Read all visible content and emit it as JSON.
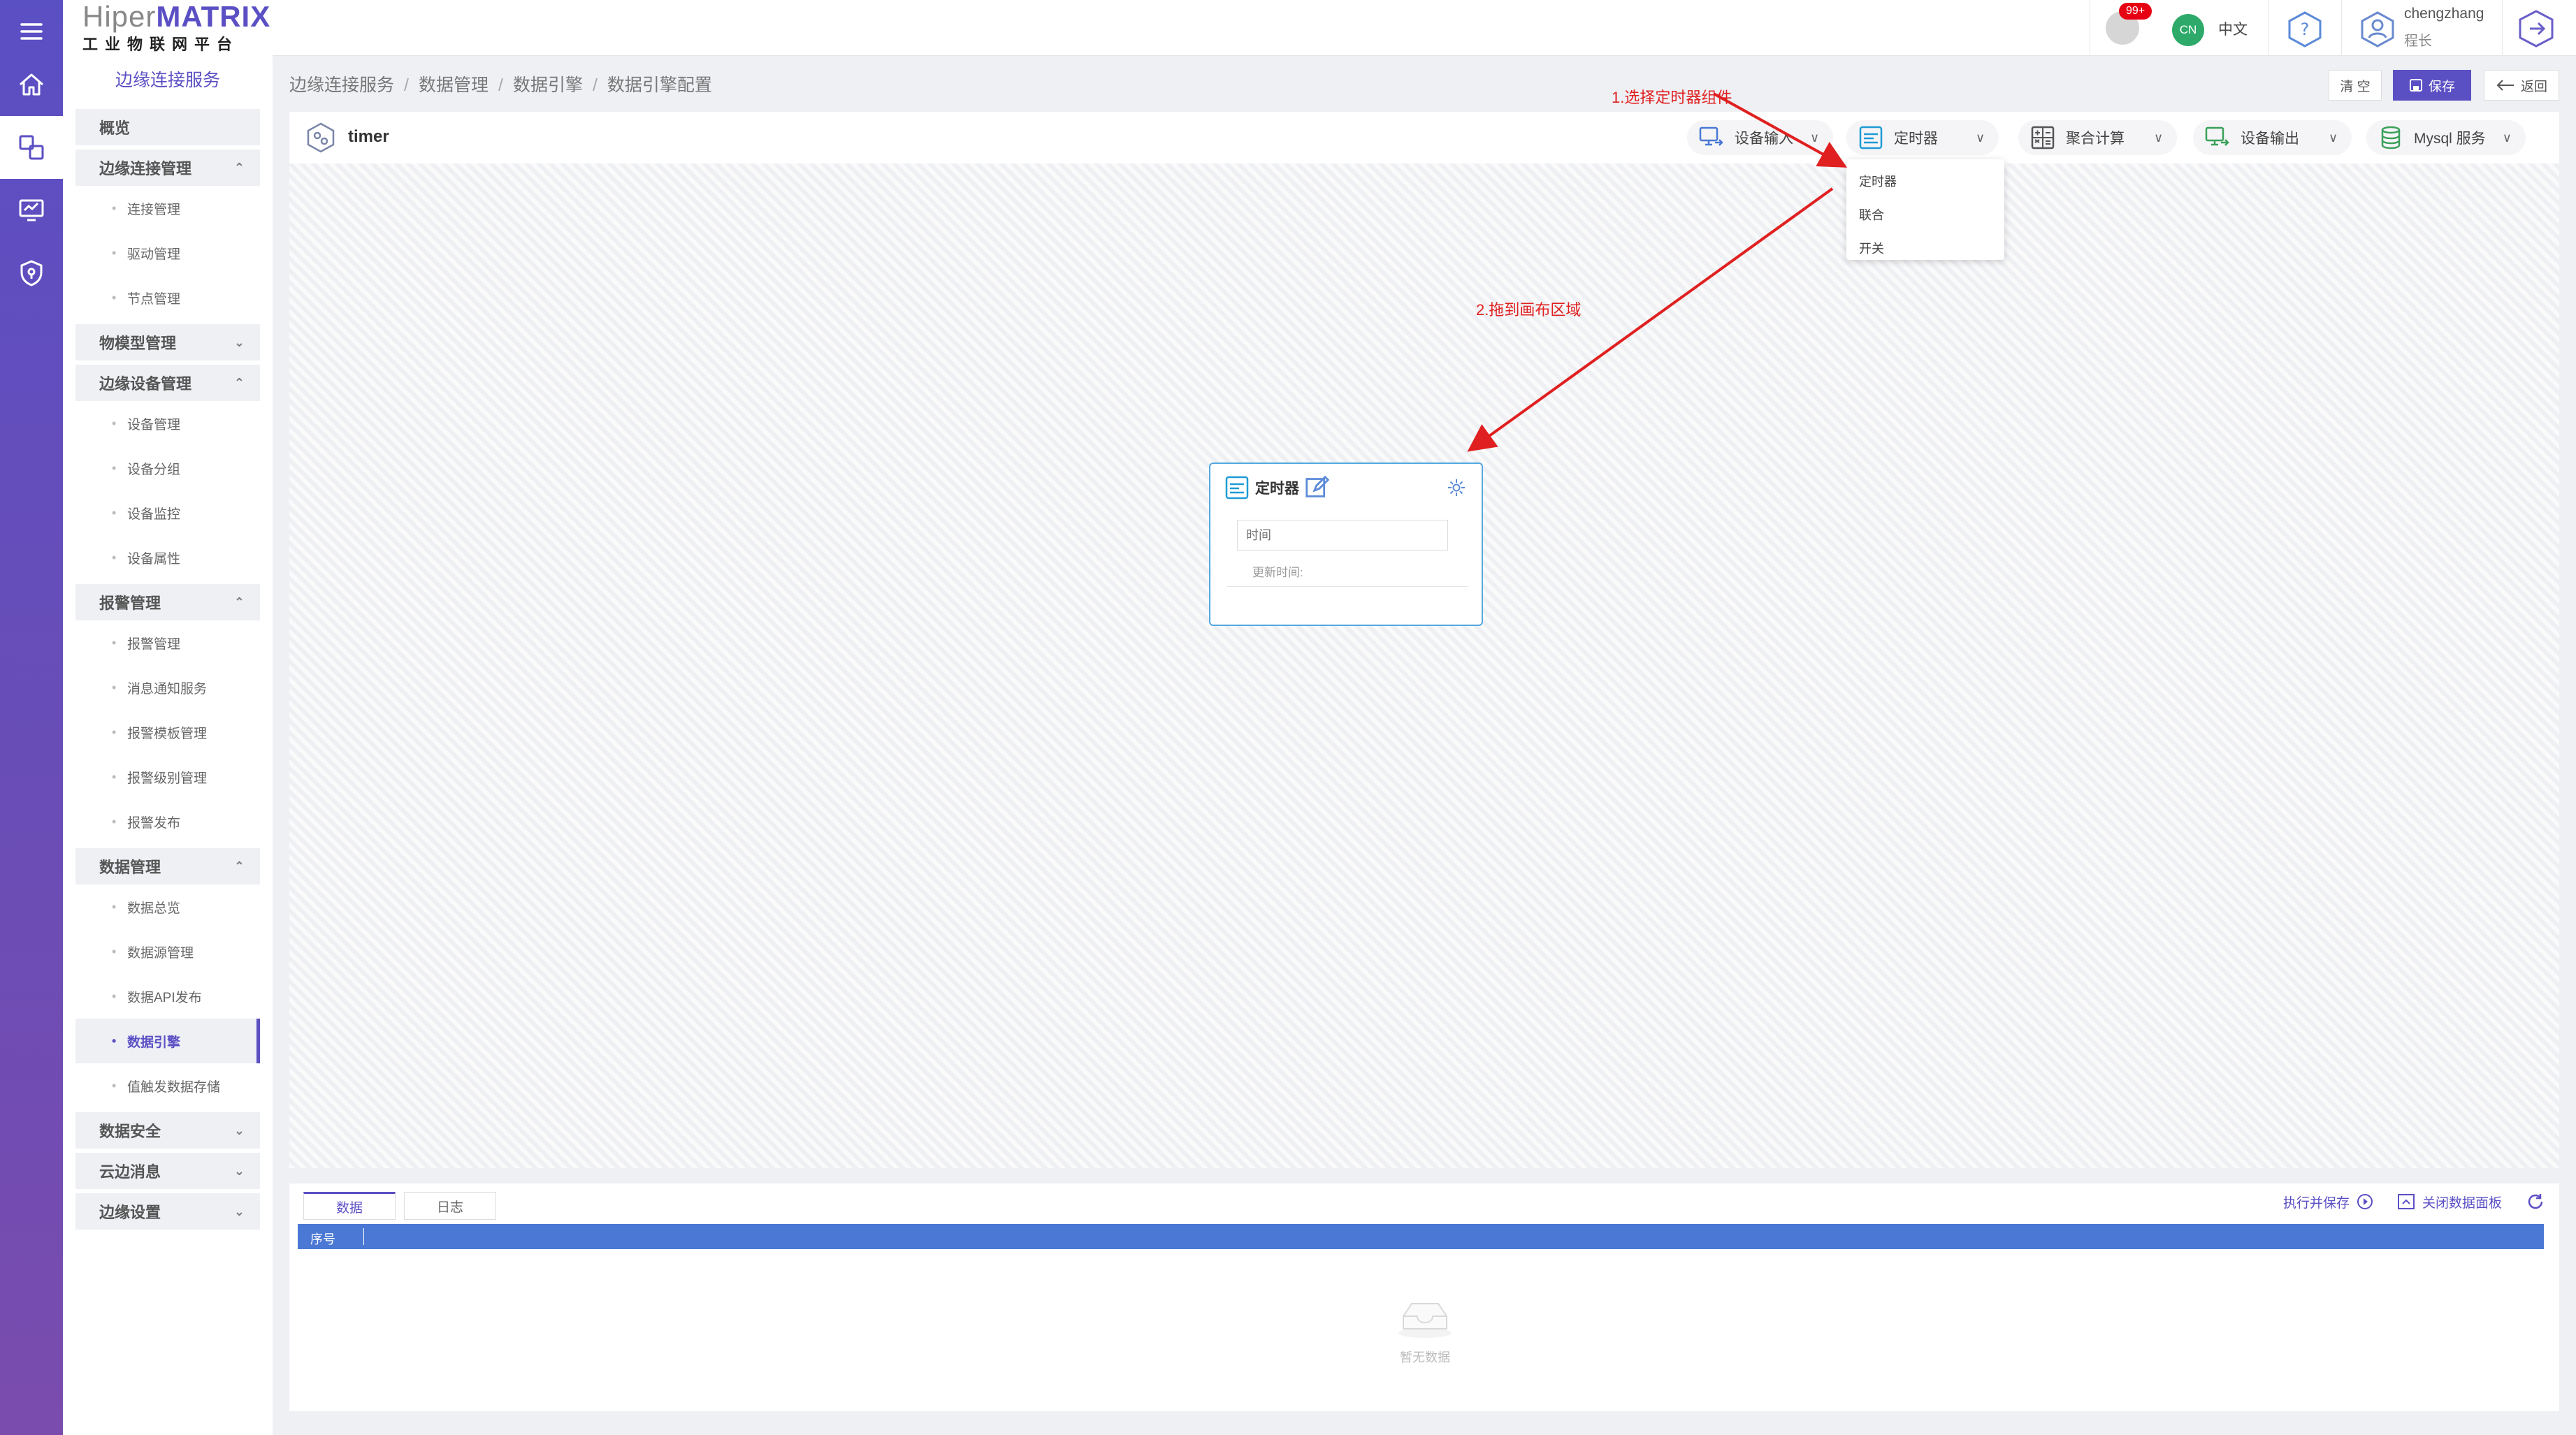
{
  "logo": {
    "brand_prefix": "Hiper",
    "brand_suffix": "MATRIX",
    "subtitle": "工业物联网平台"
  },
  "sidebar": {
    "title": "边缘连接服务",
    "items": [
      {
        "type": "group",
        "label": "概览",
        "chevron": ""
      },
      {
        "type": "group",
        "label": "边缘连接管理",
        "chevron": "^"
      },
      {
        "type": "item",
        "label": "连接管理"
      },
      {
        "type": "item",
        "label": "驱动管理"
      },
      {
        "type": "item",
        "label": "节点管理"
      },
      {
        "type": "group",
        "label": "物模型管理",
        "chevron": "v"
      },
      {
        "type": "group",
        "label": "边缘设备管理",
        "chevron": "^"
      },
      {
        "type": "item",
        "label": "设备管理"
      },
      {
        "type": "item",
        "label": "设备分组"
      },
      {
        "type": "item",
        "label": "设备监控"
      },
      {
        "type": "item",
        "label": "设备属性"
      },
      {
        "type": "group",
        "label": "报警管理",
        "chevron": "^"
      },
      {
        "type": "item",
        "label": "报警管理"
      },
      {
        "type": "item",
        "label": "消息通知服务"
      },
      {
        "type": "item",
        "label": "报警模板管理"
      },
      {
        "type": "item",
        "label": "报警级别管理"
      },
      {
        "type": "item",
        "label": "报警发布"
      },
      {
        "type": "group",
        "label": "数据管理",
        "chevron": "^"
      },
      {
        "type": "item",
        "label": "数据总览"
      },
      {
        "type": "item",
        "label": "数据源管理"
      },
      {
        "type": "item",
        "label": "数据API发布"
      },
      {
        "type": "item",
        "label": "数据引擎",
        "active": true
      },
      {
        "type": "item",
        "label": "值触发数据存储"
      },
      {
        "type": "group",
        "label": "数据安全",
        "chevron": "v"
      },
      {
        "type": "group",
        "label": "云边消息",
        "chevron": "v"
      },
      {
        "type": "group",
        "label": "边缘设置",
        "chevron": "v"
      }
    ]
  },
  "header": {
    "notifications_badge": "99+",
    "language_badge": "CN",
    "language_label": "中文",
    "user_name": "chengzhang",
    "user_role": "程长"
  },
  "breadcrumb": [
    "边缘连接服务",
    "数据管理",
    "数据引擎",
    "数据引擎配置"
  ],
  "actions": {
    "clear": "清 空",
    "save": "保存",
    "back": "返回"
  },
  "editor": {
    "flow_name": "timer",
    "tools": [
      {
        "label": "设备输入",
        "icon": "device-input-icon"
      },
      {
        "label": "定时器",
        "icon": "timer-icon"
      },
      {
        "label": "聚合计算",
        "icon": "aggregate-icon"
      },
      {
        "label": "设备输出",
        "icon": "device-output-icon"
      },
      {
        "label": "Mysql 服务",
        "icon": "database-icon"
      }
    ],
    "dropdown": [
      "定时器",
      "联合",
      "开关"
    ],
    "node": {
      "title": "定时器",
      "input_placeholder": "时间",
      "updated_label": "更新时间:"
    }
  },
  "annotations": {
    "step1": "1.选择定时器组件",
    "step2": "2.拖到画布区域",
    "color": "#e02020"
  },
  "bottom": {
    "tabs": [
      "数据",
      "日志"
    ],
    "execute_save": "执行并保存",
    "close_panel": "关闭数据面板",
    "columns": [
      "序号"
    ],
    "empty_text": "暂无数据"
  },
  "colors": {
    "accent": "#5b4fc4",
    "table_header": "#4a78d4",
    "node_border": "#54a8e0"
  }
}
